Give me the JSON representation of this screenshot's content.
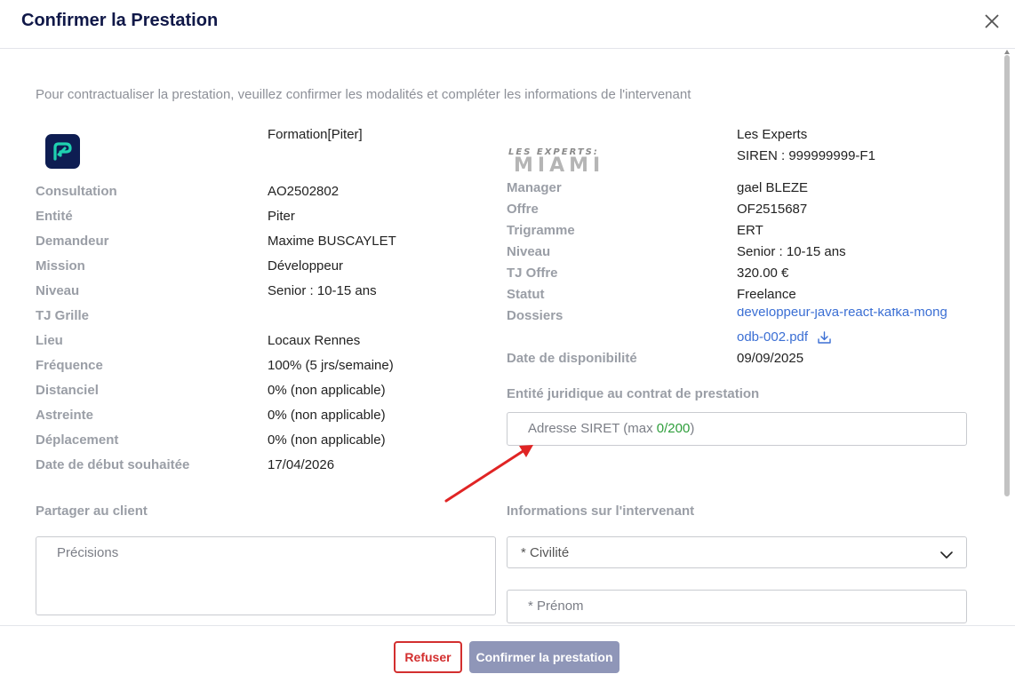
{
  "dialog": {
    "title": "Confirmer la Prestation",
    "intro": "Pour contractualiser la prestation, veuillez confirmer les modalités et compléter les informations de l'intervenant"
  },
  "left": {
    "header_value": "Formation[Piter]",
    "rows": [
      {
        "label": "Consultation",
        "value": "AO2502802"
      },
      {
        "label": "Entité",
        "value": "Piter"
      },
      {
        "label": "Demandeur",
        "value": "Maxime BUSCAYLET"
      },
      {
        "label": "Mission",
        "value": "Développeur"
      },
      {
        "label": "Niveau",
        "value": "Senior : 10-15 ans"
      },
      {
        "label": "TJ Grille",
        "value": ""
      },
      {
        "label": "Lieu",
        "value": "Locaux Rennes"
      },
      {
        "label": "Fréquence",
        "value": "100% (5 jrs/semaine)"
      },
      {
        "label": "Distanciel",
        "value": "0% (non applicable)"
      },
      {
        "label": "Astreinte",
        "value": "0% (non applicable)"
      },
      {
        "label": "Déplacement",
        "value": "0% (non applicable)"
      },
      {
        "label": "Date de début souhaitée",
        "value": "17/04/2026"
      }
    ]
  },
  "right": {
    "logo_text_top": "LES EXPERTS:",
    "logo_text_main": "MIAMI",
    "company": "Les Experts",
    "siren": "SIREN : 999999999-F1",
    "rows": [
      {
        "label": "Manager",
        "value": "gael BLEZE"
      },
      {
        "label": "Offre",
        "value": "OF2515687"
      },
      {
        "label": "Trigramme",
        "value": "ERT"
      },
      {
        "label": "Niveau",
        "value": "Senior : 10-15 ans"
      },
      {
        "label": "TJ Offre",
        "value": "320.00 €"
      },
      {
        "label": "Statut",
        "value": "Freelance"
      }
    ],
    "dossiers_label": "Dossiers",
    "dossiers_link_hidden": "developpeur-java-react-kafka-mong",
    "dossiers_link_visible": "odb-002.pdf",
    "date_dispo_label": "Date de disponibilité",
    "date_dispo_value": "09/09/2025"
  },
  "entity_section": {
    "title": "Entité juridique au contrat de prestation",
    "siret_placeholder_prefix": "Adresse SIRET (max ",
    "siret_count": "0/200",
    "siret_placeholder_suffix": ")"
  },
  "share_section": {
    "title": "Partager au client",
    "precisions_placeholder": "Précisions"
  },
  "intervenant_section": {
    "title": "Informations sur l'intervenant",
    "civilite_placeholder": "* Civilité",
    "prenom_placeholder": "* Prénom"
  },
  "footer": {
    "refuse_label": "Refuser",
    "confirm_label": "Confirmer la prestation"
  },
  "colors": {
    "title": "#101848",
    "link": "#3b6fd4",
    "refuse": "#d32f2f",
    "confirm_bg": "#8f96b8",
    "counter": "#2e9e3b",
    "arrow": "#e02424"
  }
}
